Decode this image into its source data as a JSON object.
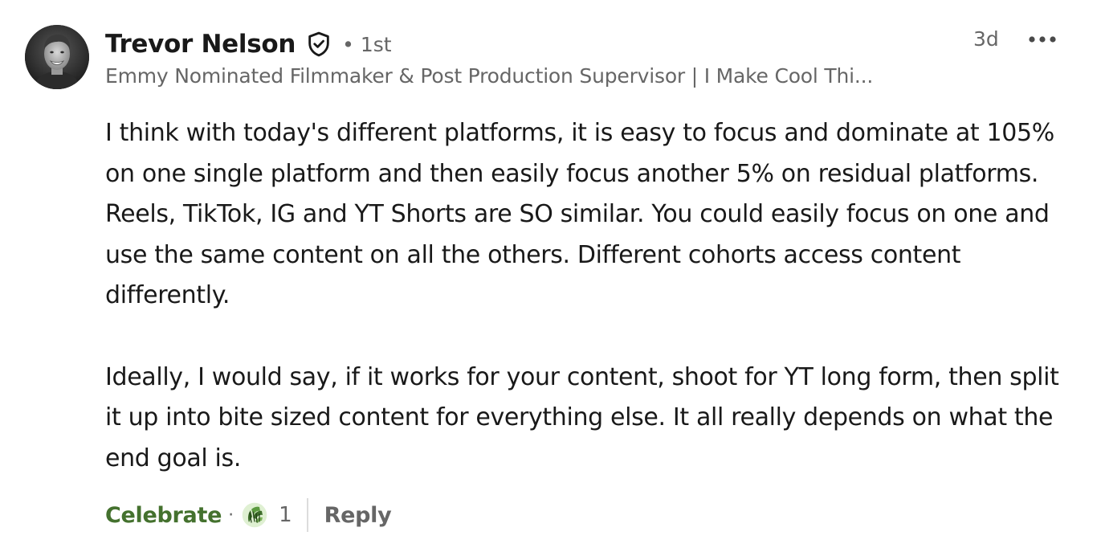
{
  "comment": {
    "author_name": "Trevor Nelson",
    "verified_icon": "shield-check-icon",
    "degree": "• 1st",
    "headline": "Emmy Nominated Filmmaker & Post Production Supervisor | I Make Cool Thi...",
    "timestamp": "3d",
    "more_icon": "ellipsis-icon",
    "paragraphs": [
      "I think with today's different platforms, it is easy to focus and dominate at 105% on one single platform and then easily focus another 5% on residual platforms. Reels, TikTok, IG and YT Shorts are SO similar. You could easily focus on one and use the same content on all the others. Different cohorts access content differently.",
      "Ideally, I would say, if it works for your content, shoot for YT long form, then split it up into bite sized content for everything else. It all really depends on what the end goal is."
    ],
    "actions": {
      "react_label": "Celebrate",
      "separator": "·",
      "reaction_icon": "celebrate-icon",
      "reaction_count": "1",
      "reply_label": "Reply"
    }
  },
  "colors": {
    "celebrate_green": "#44712e",
    "secondary_text": "#666666",
    "primary_text": "#191919"
  }
}
